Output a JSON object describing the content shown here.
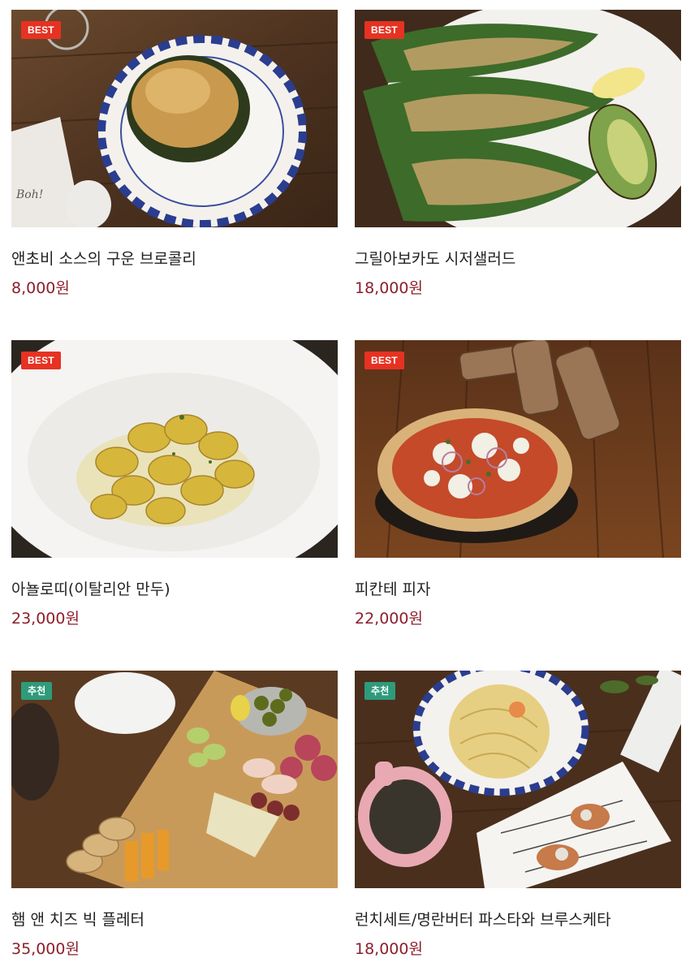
{
  "menu": {
    "items": [
      {
        "name": "앤초비 소스의 구운 브로콜리",
        "price": "8,000원",
        "badge": "BEST",
        "badge_type": "best",
        "image": "baked-broccoli-plate"
      },
      {
        "name": "그릴아보카도 시저샐러드",
        "price": "18,000원",
        "badge": "BEST",
        "badge_type": "best",
        "image": "caesar-salad-avocado"
      },
      {
        "name": "아뇰로띠(이탈리안 만두)",
        "price": "23,000원",
        "badge": "BEST",
        "badge_type": "best",
        "image": "agnolotti-bowl"
      },
      {
        "name": "피칸테 피자",
        "price": "22,000원",
        "badge": "BEST",
        "badge_type": "best",
        "image": "piccante-pizza"
      },
      {
        "name": "햄 앤 치즈 빅 플레터",
        "price": "35,000원",
        "badge": "추천",
        "badge_type": "recommend",
        "image": "ham-cheese-platter"
      },
      {
        "name": "런치세트/명란버터 파스타와 브루스케타",
        "price": "18,000원",
        "badge": "추천",
        "badge_type": "recommend",
        "image": "pasta-bruschetta-set"
      }
    ]
  },
  "colors": {
    "best_badge": "#e63222",
    "recommend_badge": "#2e9b7b",
    "price": "#8c1f2c",
    "name": "#222222"
  }
}
